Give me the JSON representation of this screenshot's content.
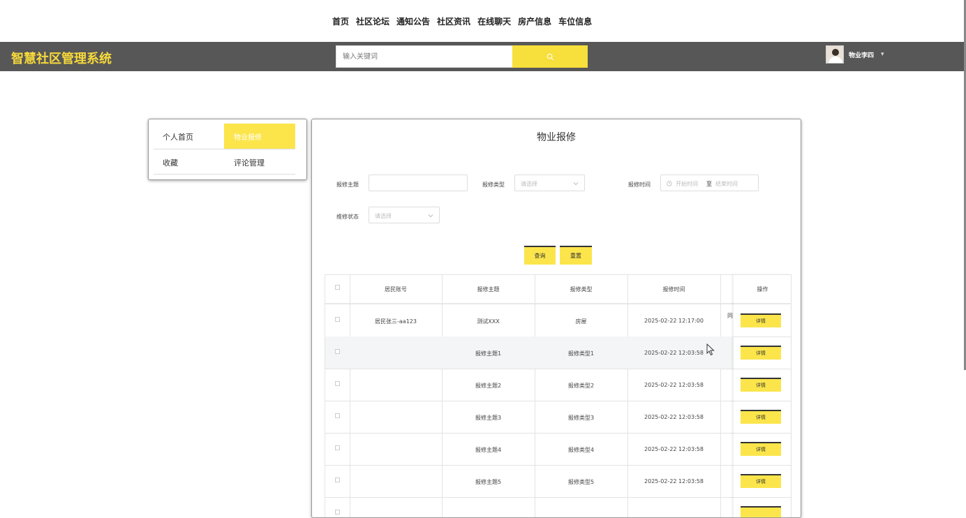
{
  "topnav": {
    "links": [
      "首页",
      "社区论坛",
      "通知公告",
      "社区资讯",
      "在线聊天",
      "房产信息",
      "车位信息"
    ]
  },
  "header": {
    "brand": "智慧社区管理系统",
    "search_placeholder": "输入关键词",
    "user_name": "物业李四",
    "user_caret": "▾"
  },
  "sidemenu": {
    "items": [
      "个人首页",
      "物业报修",
      "收藏",
      "评论管理"
    ],
    "active": "物业报修"
  },
  "panel": {
    "title": "物业报修",
    "filters": {
      "subject_label": "报修主题",
      "type_label": "报修类型",
      "type_placeholder": "请选择",
      "time_label": "报修时间",
      "start_placeholder": "开始时间",
      "range_sep": "至",
      "end_placeholder": "结束时间",
      "status_label": "维修状态",
      "status_placeholder": "请选择"
    },
    "buttons": {
      "query": "查询",
      "reset": "重置"
    }
  },
  "table": {
    "columns": [
      "居民账号",
      "报修主题",
      "报修类型",
      "报修时间",
      "",
      "操作"
    ],
    "partial_cell": "同",
    "rows": [
      {
        "account": "居民张三-aa123",
        "subject": "测试XXX",
        "type": "房屋",
        "time": "2025-02-22 12:17:00"
      },
      {
        "account": "",
        "subject": "报修主题1",
        "type": "报修类型1",
        "time": "2025-02-22 12:03:58"
      },
      {
        "account": "",
        "subject": "报修主题2",
        "type": "报修类型2",
        "time": "2025-02-22 12:03:58"
      },
      {
        "account": "",
        "subject": "报修主题3",
        "type": "报修类型3",
        "time": "2025-02-22 12:03:58"
      },
      {
        "account": "",
        "subject": "报修主题4",
        "type": "报修类型4",
        "time": "2025-02-22 12:03:58"
      },
      {
        "account": "",
        "subject": "报修主题5",
        "type": "报修类型5",
        "time": "2025-02-22 12:03:58"
      }
    ],
    "detail_label": "详情"
  },
  "colors": {
    "accent": "#fbe54b",
    "header_bg": "#575757",
    "brand": "#f7d93a"
  }
}
